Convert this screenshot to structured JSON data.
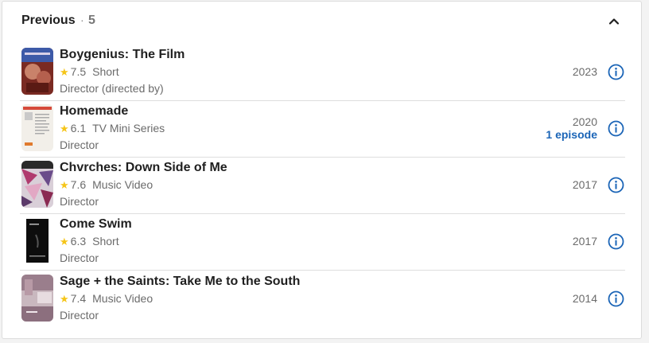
{
  "header": {
    "title": "Previous",
    "separator": "·",
    "count": "5"
  },
  "colors": {
    "accent": "#1b65b7",
    "star": "#f5c518",
    "text_primary": "#1f1f1f",
    "text_secondary": "#6b6b6b"
  },
  "items": [
    {
      "title": "Boygenius: The Film",
      "rating": "7.5",
      "type": "Short",
      "role": "Director (directed by)",
      "year": "2023",
      "episodes": ""
    },
    {
      "title": "Homemade",
      "rating": "6.1",
      "type": "TV Mini Series",
      "role": "Director",
      "year": "2020",
      "episodes": "1 episode"
    },
    {
      "title": "Chvrches: Down Side of Me",
      "rating": "7.6",
      "type": "Music Video",
      "role": "Director",
      "year": "2017",
      "episodes": ""
    },
    {
      "title": "Come Swim",
      "rating": "6.3",
      "type": "Short",
      "role": "Director",
      "year": "2017",
      "episodes": ""
    },
    {
      "title": "Sage + the Saints: Take Me to the South",
      "rating": "7.4",
      "type": "Music Video",
      "role": "Director",
      "year": "2014",
      "episodes": ""
    }
  ],
  "icons": {
    "collapse": "chevron-up-icon",
    "info": "info-circle-icon",
    "star": "star-icon"
  }
}
